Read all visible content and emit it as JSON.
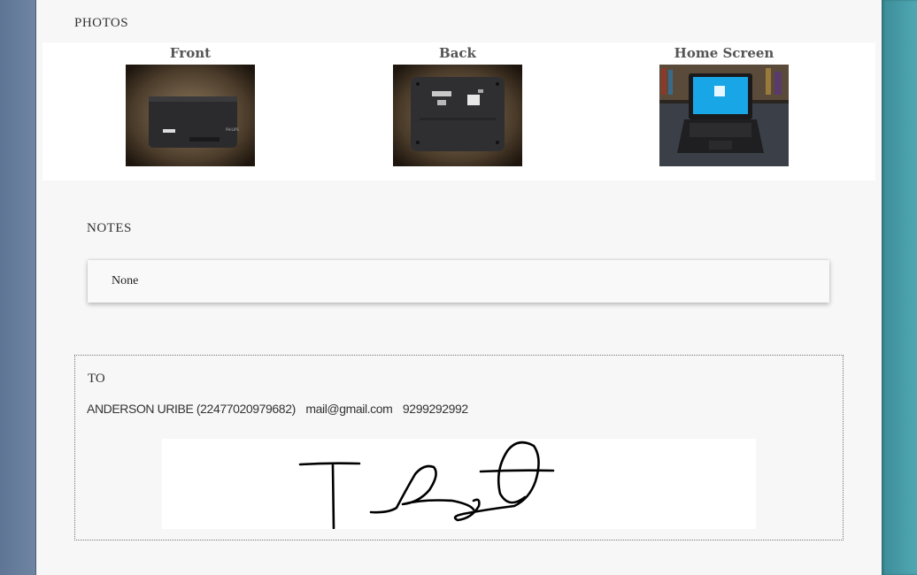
{
  "photos": {
    "title": "PHOTOS",
    "items": [
      {
        "caption": "Front",
        "icon": "laptop-front-photo"
      },
      {
        "caption": "Back",
        "icon": "laptop-back-photo"
      },
      {
        "caption": "Home Screen",
        "icon": "laptop-home-screen-photo"
      }
    ]
  },
  "notes": {
    "title": "NOTES",
    "text": "None"
  },
  "to": {
    "title": "TO",
    "name": "ANDERSON URIBE (22477020979682)",
    "email": "mail@gmail.com",
    "phone": "9299292992",
    "signature": "handwritten-signature"
  }
}
